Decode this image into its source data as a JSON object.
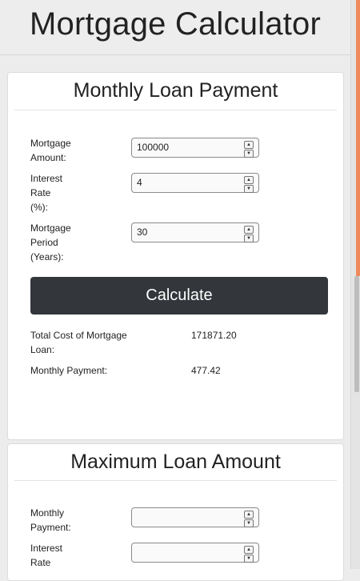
{
  "header": {
    "title": "Mortgage Calculator"
  },
  "monthly_card": {
    "title": "Monthly Loan Payment",
    "fields": [
      {
        "label_lines": [
          "Mortgage",
          "Amount:"
        ],
        "value": "100000"
      },
      {
        "label_lines": [
          "Interest",
          "Rate",
          "(%):"
        ],
        "value": "4"
      },
      {
        "label_lines": [
          "Mortgage",
          "Period",
          "(Years):"
        ],
        "value": "30"
      }
    ],
    "button_label": "Calculate",
    "results": [
      {
        "label_lines": [
          "Total Cost of Mortgage",
          "Loan:"
        ],
        "value": "171871.20"
      },
      {
        "label_lines": [
          "Monthly Payment:"
        ],
        "value": "477.42"
      }
    ]
  },
  "max_card": {
    "title": "Maximum Loan Amount",
    "fields": [
      {
        "label_lines": [
          "Monthly",
          "Payment:"
        ],
        "value": ""
      },
      {
        "label_lines": [
          "Interest",
          "Rate"
        ],
        "value": ""
      }
    ]
  },
  "colors": {
    "accent": "#f08a5d",
    "button_bg": "#33363b"
  }
}
